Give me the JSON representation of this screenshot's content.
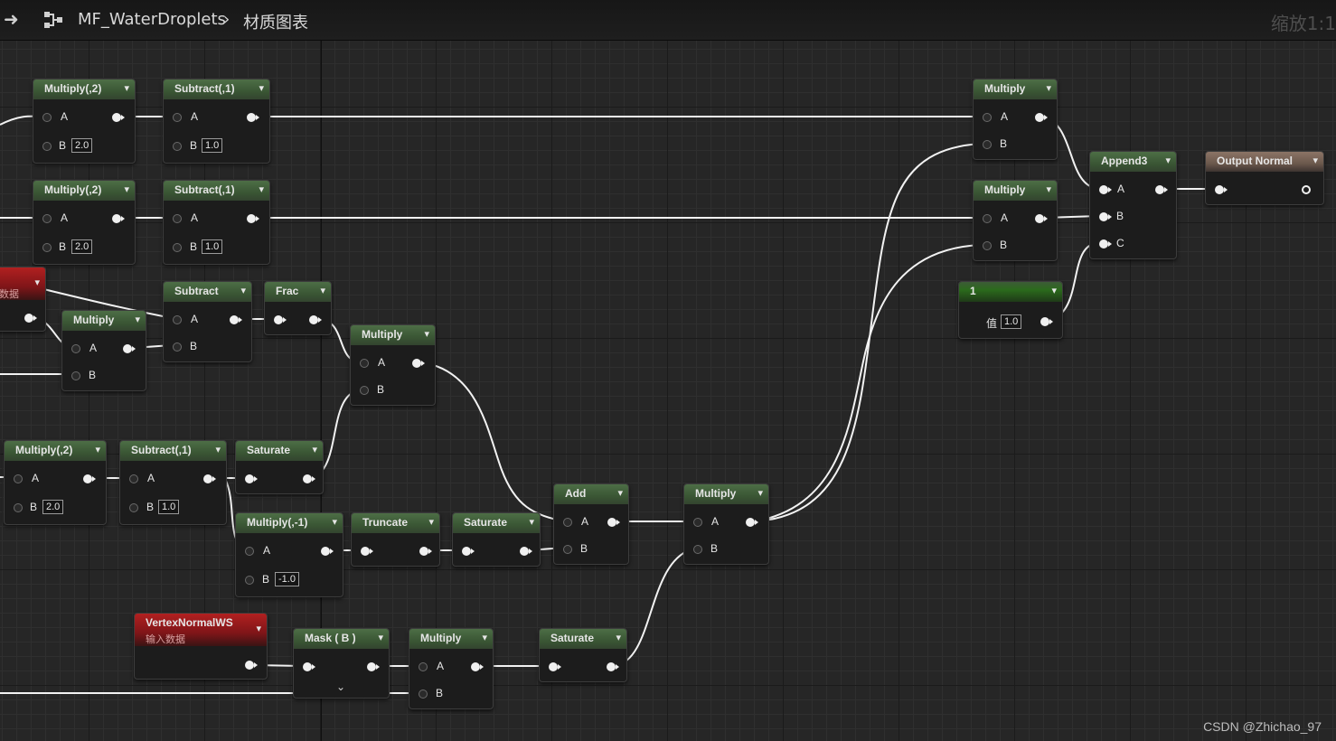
{
  "topbar": {
    "breadcrumb": "MF_WaterDroplets",
    "graph": "材质图表",
    "zoom": "缩放1:1"
  },
  "watermark": "CSDN @Zhichao_97",
  "nodes": {
    "n1": {
      "title": "Multiply(,2)",
      "a": "A",
      "b": "B",
      "bval": "2.0"
    },
    "n2": {
      "title": "Subtract(,1)",
      "a": "A",
      "b": "B",
      "bval": "1.0"
    },
    "n3": {
      "title": "Multiply(,2)",
      "a": "A",
      "b": "B",
      "bval": "2.0"
    },
    "n4": {
      "title": "Subtract(,1)",
      "a": "A",
      "b": "B",
      "bval": "1.0"
    },
    "n5": {
      "sub": "数据"
    },
    "n6": {
      "title": "Multiply",
      "a": "A",
      "b": "B"
    },
    "n7": {
      "title": "Subtract",
      "a": "A",
      "b": "B"
    },
    "n8": {
      "title": "Frac"
    },
    "n9": {
      "title": "Multiply",
      "a": "A",
      "b": "B"
    },
    "n10": {
      "title": "Multiply(,2)",
      "a": "A",
      "b": "B",
      "bval": "2.0"
    },
    "n11": {
      "title": "Subtract(,1)",
      "a": "A",
      "b": "B",
      "bval": "1.0"
    },
    "n12": {
      "title": "Saturate"
    },
    "n13": {
      "title": "Multiply(,-1)",
      "a": "A",
      "b": "B",
      "bval": "-1.0"
    },
    "n14": {
      "title": "Truncate"
    },
    "n15": {
      "title": "Saturate"
    },
    "n16": {
      "title": "Add",
      "a": "A",
      "b": "B"
    },
    "n17": {
      "title": "Multiply",
      "a": "A",
      "b": "B"
    },
    "n18": {
      "title": "VertexNormalWS",
      "sub": "输入数据"
    },
    "n19": {
      "title": "Mask ( B )"
    },
    "n20": {
      "title": "Multiply",
      "a": "A",
      "b": "B"
    },
    "n21": {
      "title": "Saturate"
    },
    "n22": {
      "title": "Multiply",
      "a": "A",
      "b": "B"
    },
    "n23": {
      "title": "Multiply",
      "a": "A",
      "b": "B"
    },
    "n24": {
      "title": "Append3",
      "a": "A",
      "b": "B",
      "c": "C"
    },
    "n25": {
      "title": "Output Normal"
    },
    "n26": {
      "title": "1",
      "vlabel": "值",
      "val": "1.0"
    }
  }
}
